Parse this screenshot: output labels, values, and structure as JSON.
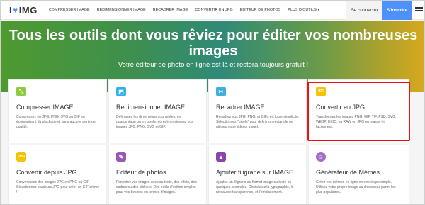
{
  "logo": {
    "brand": "IMG",
    "letter": "I"
  },
  "nav": {
    "items": [
      "COMPRESSER IMAGE",
      "REDIMENSIONNER IMAGE",
      "RECADRER IMAGE",
      "CONVERTIR EN JPG",
      "EDITEUR DE PHOTOS",
      "PLUS D'OUTILS ▾"
    ],
    "login": "Se connecter",
    "signup": "S'inscrire"
  },
  "hero": {
    "title": "Tous les outils dont vous rêviez pour éditer vos nombreuses images",
    "subtitle": "Votre éditeur de photo en ligne est là et restera toujours gratuit !"
  },
  "cards": [
    {
      "title": "Compresser IMAGE",
      "desc": "Compressez en JPG, PNG, SVG ou GIF en économisant du stockage et sans aucune perte de qualité.",
      "color": "#8fc93f",
      "icon": "compress-icon"
    },
    {
      "title": "Redimensionner IMAGE",
      "desc": "Définissez les dimensions souhaitées, en pourcentage ou en pixels, et redimensionnez vos images JPG, PNG, SVG et GIF.",
      "color": "#2db2f0",
      "icon": "resize-icon"
    },
    {
      "title": "Recadrer IMAGE",
      "desc": "Recadrez vos JPG, PNG, et GIFs en toute simplicité. Sélectionnez \"pixels\" pour définir un rectangle ou utilisez notre éditeur visuel.",
      "color": "#3dafd8",
      "icon": "crop-icon"
    },
    {
      "title": "Convertir en JPG",
      "desc": "Transformez les images PNG, GIF, TIF, PSD, SVG, WEBP, HEIC, ou RAW en JPG en masse et facilement.",
      "color": "#f5c400",
      "icon": "convert-jpg-icon"
    },
    {
      "title": "Convertir depuis JPG",
      "desc": "Convertissez des images JPG en PNG ou GIF. Sélectionnez plusieurs JPG pour créer un GIF animé !",
      "color": "#f5c400",
      "icon": "convert-from-jpg-icon"
    },
    {
      "title": "Editeur de photos",
      "desc": "Pimentez vos images avec du texte, des effets, des cadres ou des stickers. Des outils d'édition simples pour vos besoins en termes d'images.",
      "color": "#9b59b6",
      "icon": "pencil-icon"
    },
    {
      "title": "Ajouter filigrane sur IMAGE",
      "desc": "Ajoutez un filigrane au format image ou texte en quelques secondes. Choisissez la typographie, le niveau de transparence, et l'emplacement.",
      "color": "#8e44ad",
      "icon": "watermark-icon"
    },
    {
      "title": "Générateur de Mèmes",
      "desc": "Créez vos mèmes en ligne en une étape simple. Utilisez votre propre image ou choisissez parmi les plus populaires.",
      "color": "#a46cc7",
      "icon": "meme-icon"
    }
  ],
  "colors": {
    "accent": "#4d90fe",
    "highlight": "#e11111"
  }
}
